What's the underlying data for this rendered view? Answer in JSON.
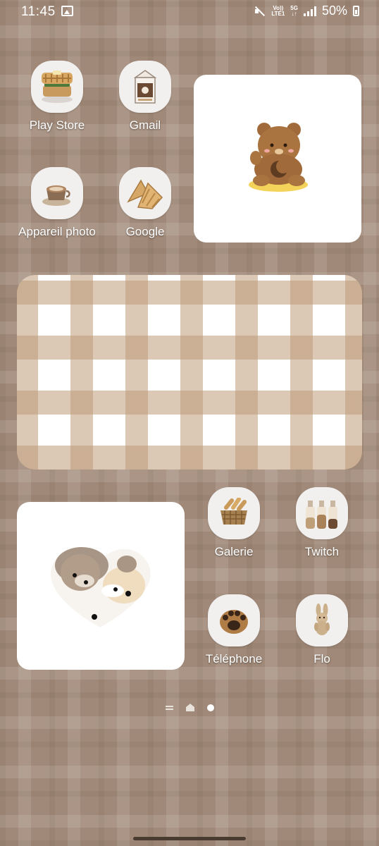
{
  "status_bar": {
    "time": "11:45",
    "volte_label": "Vo))",
    "lte_label": "LTE1",
    "fiveg_label": "5G",
    "battery": "50%"
  },
  "apps": [
    {
      "label": "Play Store",
      "icon": "waffle-icon"
    },
    {
      "label": "Gmail",
      "icon": "milk-carton-icon"
    },
    {
      "label": "Appareil photo",
      "icon": "coffee-cup-icon"
    },
    {
      "label": "Google",
      "icon": "taiyaki-icon"
    },
    {
      "label": "Galerie",
      "icon": "bread-basket-icon"
    },
    {
      "label": "Twitch",
      "icon": "milk-bottles-icon"
    },
    {
      "label": "Téléphone",
      "icon": "paw-cookie-icon"
    },
    {
      "label": "Flo",
      "icon": "bunny-plush-icon"
    }
  ],
  "widgets": {
    "bear_widget": "bear-sticker-image",
    "gingham_widget": "gingham-pattern-image",
    "heart_widget": "bears-heart-image"
  },
  "page_indicator": {
    "pages": [
      "menu-lines-icon",
      "home-icon",
      "page-dot-icon"
    ],
    "active_index": 2
  },
  "colors": {
    "wallpaper": "#a08978",
    "icon_bg": "#f1f0ef",
    "bear_brown": "#a06a3a"
  }
}
